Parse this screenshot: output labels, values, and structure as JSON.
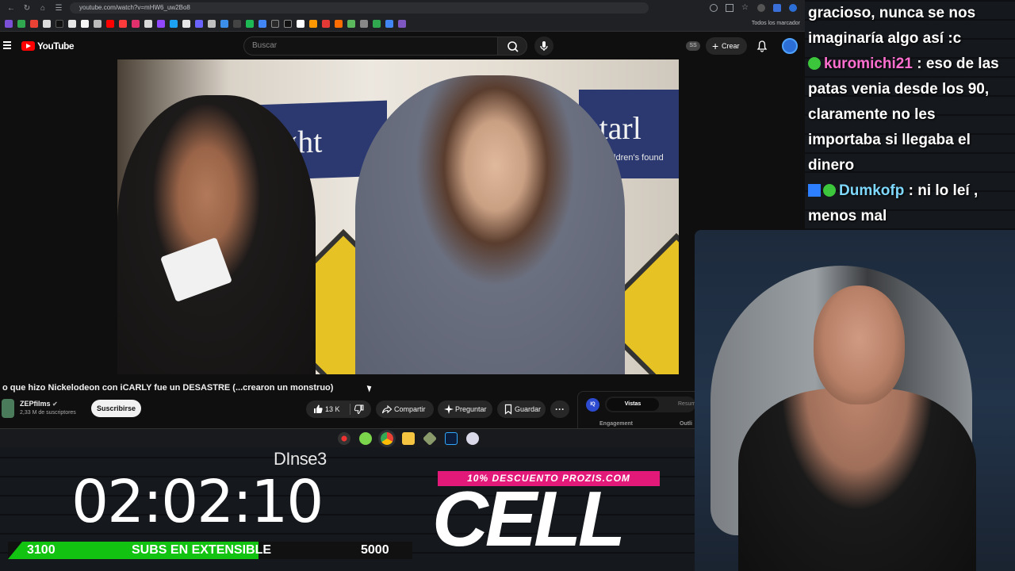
{
  "browser": {
    "url": "youtube.com/watch?v=mHW6_uw2Bo8",
    "bookmarks_all_label": "Todos los marcador"
  },
  "youtube": {
    "logo_text": "YouTube",
    "search_placeholder": "Buscar",
    "ss_badge": "SS",
    "create_label": "Crear"
  },
  "video": {
    "banner_left_text": "light",
    "banner_right_text": "starl",
    "banner_right_sub": "children's found",
    "title": "o que hizo Nickelodeon con iCARLY fue un DESASTRE (...crearon un monstruo)",
    "channel_name": "ZEPfilms",
    "channel_subs": "2,33 M de suscriptores",
    "subscribe_label": "Suscribirse",
    "likes": "13 K",
    "share_label": "Compartir",
    "ask_label": "Preguntar",
    "save_label": "Guardar",
    "more_label": "···"
  },
  "side_panel": {
    "iq_badge": "IQ",
    "tab_active": "Vistas",
    "tab_other": "Resum",
    "label_left": "Engagement",
    "label_right": "Outli"
  },
  "overlay": {
    "brand": "DInse3",
    "timer": "02:02:10",
    "subs_current": "3100",
    "subs_label": "SUBS EN EXTENSIBLE",
    "subs_goal": "5000",
    "subs_progress": 0.62,
    "promo": "10% DESCUENTO PROZIS.COM",
    "cell_text": "CELL"
  },
  "chat": [
    {
      "user": "",
      "message": "gracioso, nunca se nos imaginaría algo así :c"
    },
    {
      "user": "kuromichi21",
      "message": ": eso de las patas venia desde los 90, claramente no les importaba si llegaba el dinero"
    },
    {
      "user": "Dumkofp",
      "message": ": ni lo leí , menos mal"
    }
  ],
  "colors": {
    "youtube_red": "#ff0000",
    "sub_bar_green": "#12c312",
    "promo_pink": "#e3197a",
    "chat_user_pink": "#ff6fcf",
    "chat_user_blue": "#7fd9ff"
  }
}
